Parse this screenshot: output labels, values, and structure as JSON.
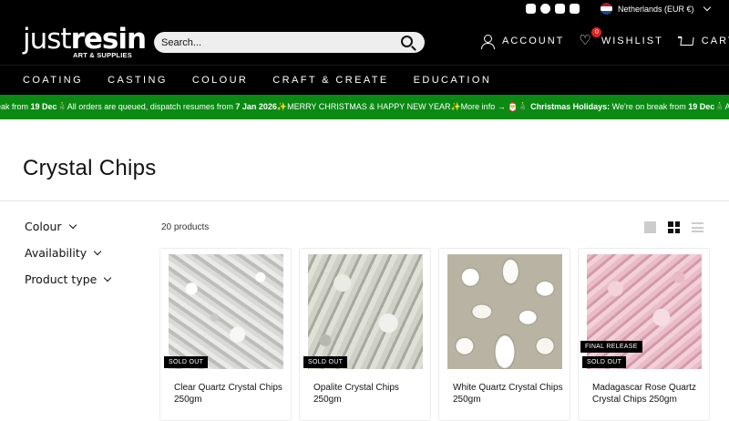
{
  "topbar": {
    "social_icons": [
      "instagram-icon",
      "facebook-icon",
      "youtube-icon",
      "tiktok-icon"
    ],
    "region_label": "Netherlands (EUR €)"
  },
  "header": {
    "logo_main_light": "just",
    "logo_main_bold": "resin",
    "logo_sub": "ART & SUPPLIES",
    "search_placeholder": "Search...",
    "account_label": "ACCOUNT",
    "wishlist_label": "WISHLIST",
    "wishlist_count": "0",
    "cart_label": "CART"
  },
  "nav": {
    "items": [
      "COATING",
      "CASTING",
      "COLOUR",
      "CRAFT & CREATE",
      "EDUCATION"
    ]
  },
  "announcement": {
    "seg1": "eak from ",
    "seg1_bold": "19 Dec",
    "seg2": "🎄All orders are queued, dispatch resumes from ",
    "seg2_bold": "7 Jan 2026",
    "seg3": "✨MERRY CHRISTMAS & HAPPY NEW YEAR✨More info → 🎅🎄 ",
    "seg3_bold": "Christmas Holidays:",
    "seg4": " We're on break from ",
    "seg4_bold": "19 Dec",
    "seg5": "🎄All orders are queued, dispatch resumes from"
  },
  "page": {
    "title": "Crystal Chips",
    "product_count": "20 products"
  },
  "filters": [
    "Colour",
    "Availability",
    "Product type"
  ],
  "products": [
    {
      "title": "Clear Quartz Crystal Chips 250gm",
      "badge": "SOLD OUT",
      "badge2": ""
    },
    {
      "title": "Opalite Crystal Chips 250gm",
      "badge": "SOLD OUT",
      "badge2": ""
    },
    {
      "title": "White Quartz Crystal Chips 250gm",
      "badge": "",
      "badge2": ""
    },
    {
      "title": "Madagascar Rose Quartz Crystal Chips 250gm",
      "badge": "SOLD OUT",
      "badge2": "FINAL RELEASE"
    }
  ],
  "colors": {
    "header_bg": "#000000",
    "announcement_bg": "#0a8a13",
    "badge_bg": "#000000",
    "wishlist_badge": "#dd2222"
  }
}
